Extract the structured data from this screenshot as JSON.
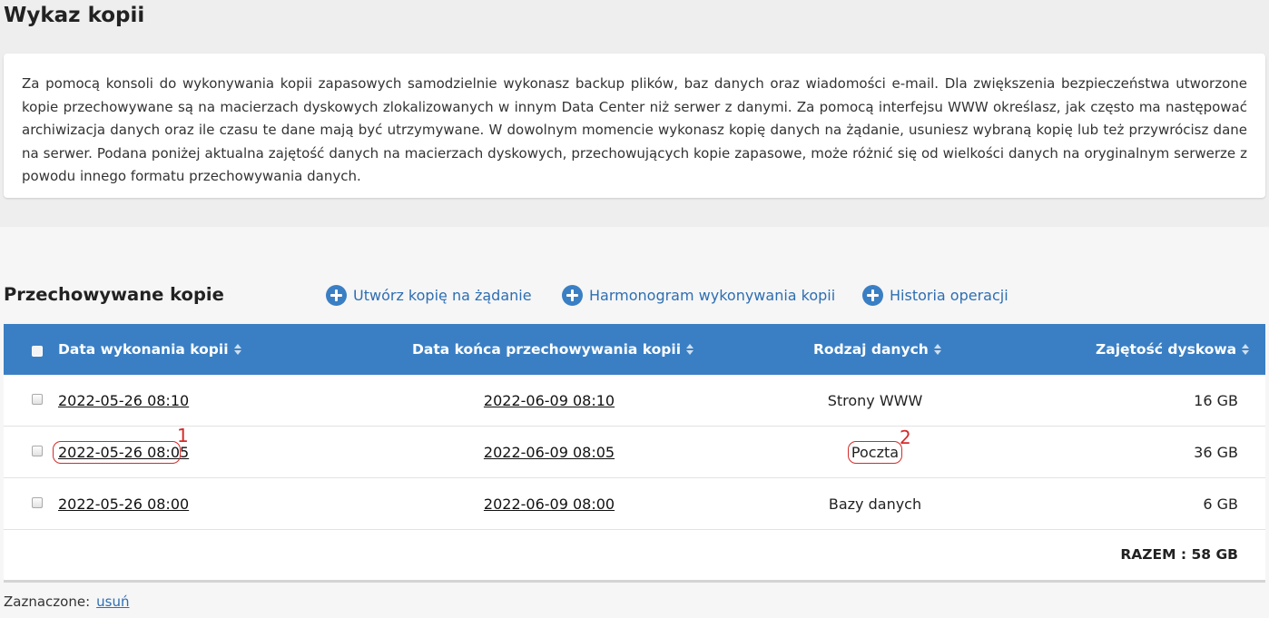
{
  "page_title": "Wykaz kopii",
  "info_text": "Za pomocą konsoli do wykonywania kopii zapasowych samodzielnie wykonasz backup plików, baz danych oraz wiadomości e-mail. Dla zwiększenia bezpieczeństwa utworzone kopie przechowywane są na macierzach dyskowych zlokalizowanych w innym Data Center niż serwer z danymi. Za pomocą interfejsu WWW określasz, jak często ma następować archiwizacja danych oraz ile czasu te dane mają być utrzymywane. W dowolnym momencie wykonasz kopię danych na żądanie, usuniesz wybraną kopię lub też przywrócisz dane na serwer. Podana poniżej aktualna zajętość danych na macierzach dyskowych, przechowujących kopie zapasowe, może różnić się od wielkości danych na oryginalnym serwerze z powodu innego formatu przechowywania danych.",
  "section_title": "Przechowywane kopie",
  "actions": {
    "create": "Utwórz kopię na żądanie",
    "schedule": "Harmonogram wykonywania kopii",
    "history": "Historia operacji"
  },
  "table": {
    "headers": {
      "created": "Data wykonania kopii",
      "expires": "Data końca przechowywania kopii",
      "type": "Rodzaj danych",
      "size": "Zajętość dyskowa"
    },
    "rows": [
      {
        "created": "2022-05-26 08:10",
        "expires": "2022-06-09 08:10",
        "type": "Strony WWW",
        "size": "16 GB"
      },
      {
        "created": "2022-05-26 08:05",
        "expires": "2022-06-09 08:05",
        "type": "Poczta",
        "size": "36 GB"
      },
      {
        "created": "2022-05-26 08:00",
        "expires": "2022-06-09 08:00",
        "type": "Bazy danych",
        "size": "6 GB"
      }
    ],
    "total": "RAZEM : 58 GB"
  },
  "annotations": {
    "marker_1": "1",
    "marker_2": "2",
    "color": "#d42a2a"
  },
  "footer": {
    "label": "Zaznaczone:",
    "delete_link": "usuń"
  },
  "colors": {
    "header_bg": "#3a7fc4",
    "link": "#2d6eb2"
  }
}
